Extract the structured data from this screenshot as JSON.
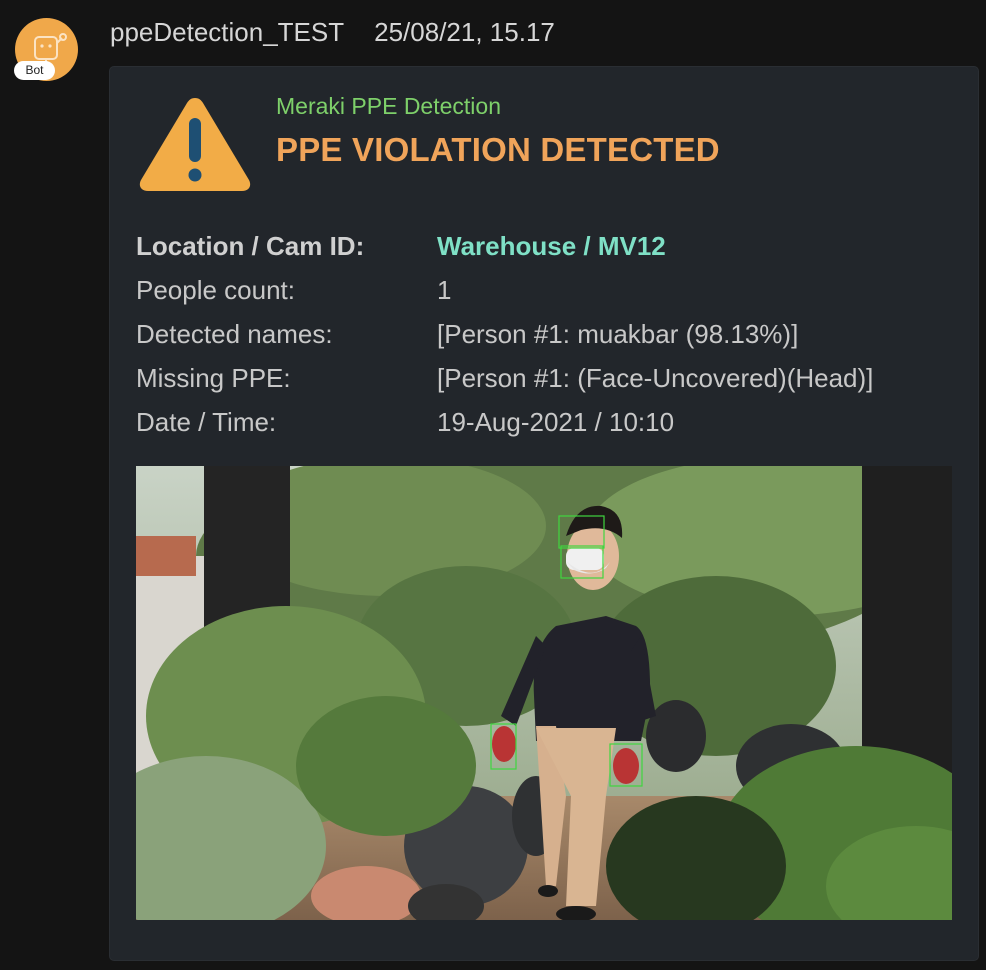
{
  "message": {
    "sender": "ppeDetection_TEST",
    "timestamp": "25/08/21, 15.17",
    "bot_badge": "Bot"
  },
  "card": {
    "subtitle": "Meraki PPE Detection",
    "title": "PPE VIOLATION DETECTED",
    "facts": [
      {
        "label": "Location / Cam ID:",
        "value": "Warehouse / MV12"
      },
      {
        "label": "People count:",
        "value": "1"
      },
      {
        "label": "Detected names:",
        "value": "[Person #1: muakbar (98.13%)]"
      },
      {
        "label": "Missing PPE:",
        "value": "[Person #1: (Face-Uncovered)(Head)]"
      },
      {
        "label": "Date / Time:",
        "value": "19-Aug-2021 / 10:10"
      }
    ]
  },
  "icons": {
    "warning": "warning-triangle-icon",
    "avatar": "bot-avatar-icon"
  },
  "colors": {
    "background": "#141414",
    "card": "#22262b",
    "avatar": "#f0a84a",
    "subtitle": "#7ed06a",
    "title": "#f0a45a",
    "location_value": "#7fe0c6",
    "detection_box": "#3fd63f"
  }
}
